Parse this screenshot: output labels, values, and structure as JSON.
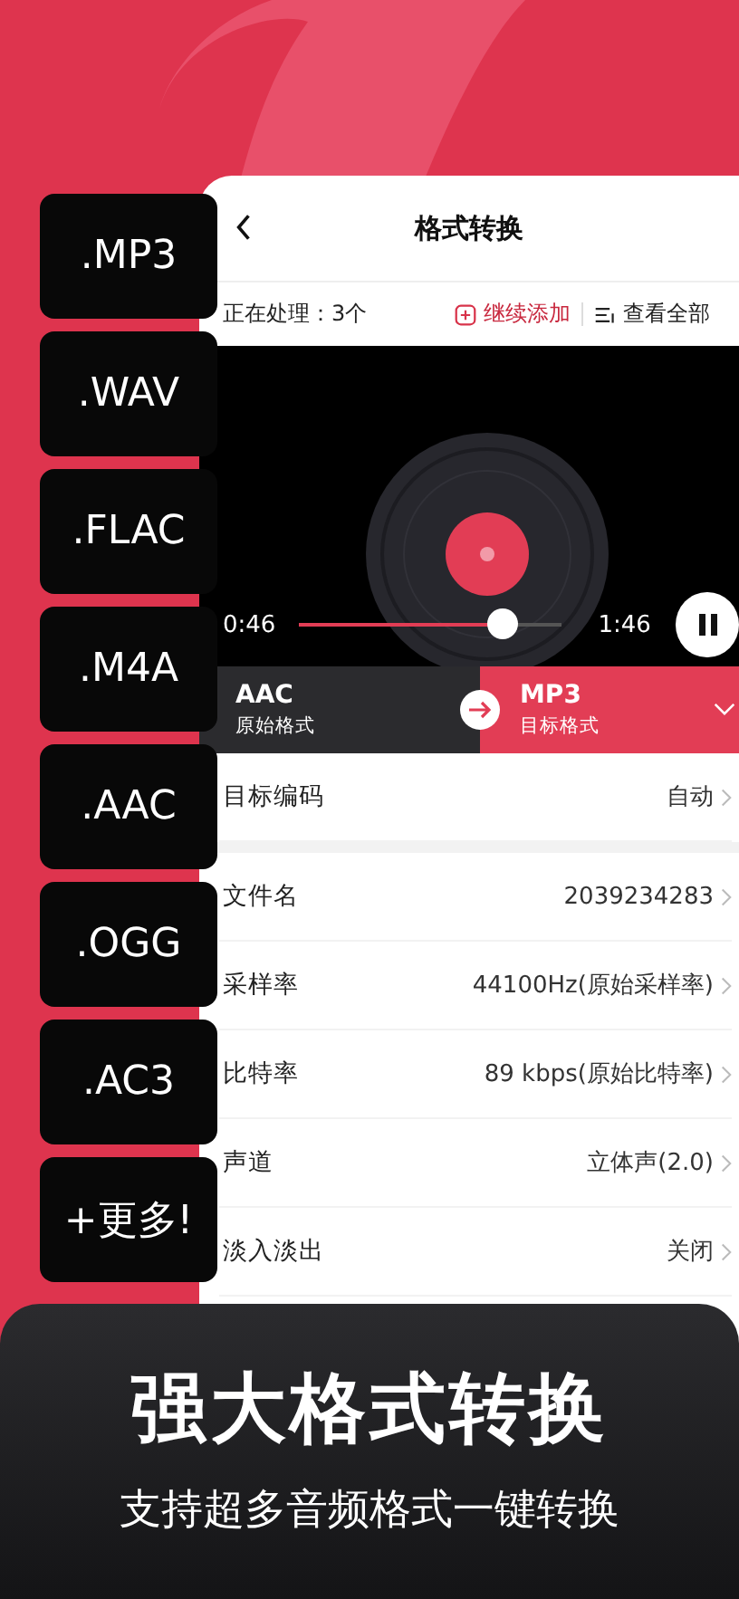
{
  "format_tiles": [
    ".MP3",
    ".WAV",
    ".FLAC",
    ".M4A",
    ".AAC",
    ".OGG",
    ".AC3",
    "+更多!"
  ],
  "header": {
    "title": "格式转换"
  },
  "processing": {
    "label": "正在处理：3个",
    "add_label": "继续添加",
    "view_all_label": "查看全部"
  },
  "player": {
    "elapsed": "0:46",
    "duration": "1:46",
    "level": 0.77,
    "playing": true
  },
  "formats": {
    "source": "AAC",
    "source_caption": "原始格式",
    "target": "MP3",
    "target_caption": "目标格式"
  },
  "settings_groups": [
    [
      {
        "label": "目标编码",
        "value": "自动"
      }
    ],
    [
      {
        "label": "文件名",
        "value": "2039234283"
      },
      {
        "label": "采样率",
        "value": "44100Hz(原始采样率)"
      },
      {
        "label": "比特率",
        "value": "89 kbps(原始比特率)"
      },
      {
        "label": "声道",
        "value": "立体声(2.0)"
      },
      {
        "label": "淡入淡出",
        "value": "关闭"
      }
    ]
  ],
  "banner": {
    "title": "强大格式转换",
    "subtitle": "支持超多音频格式一键转换"
  }
}
